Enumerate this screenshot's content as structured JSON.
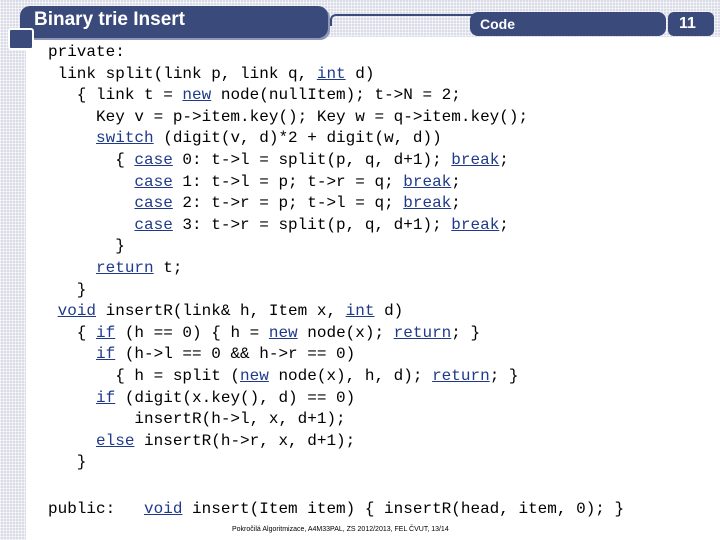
{
  "header": {
    "title": "Binary trie Insert",
    "code_label": "Code",
    "page_number": "11"
  },
  "code_lines": [
    [
      "private:"
    ],
    [
      " link split(link p, link q, ",
      {
        "kw": "int"
      },
      " d)"
    ],
    [
      "   { link t = ",
      {
        "kw": "new"
      },
      " node(nullItem); t->N = 2;"
    ],
    [
      "     Key v = p->item.key(); Key w = q->item.key();"
    ],
    [
      "     ",
      {
        "kw": "switch"
      },
      " (digit(v, d)*2 + digit(w, d))"
    ],
    [
      "       { ",
      {
        "kw": "case"
      },
      " 0: t->l = split(p, q, d+1); ",
      {
        "kw": "break"
      },
      ";"
    ],
    [
      "         ",
      {
        "kw": "case"
      },
      " 1: t->l = p; t->r = q; ",
      {
        "kw": "break"
      },
      ";"
    ],
    [
      "         ",
      {
        "kw": "case"
      },
      " 2: t->r = p; t->l = q; ",
      {
        "kw": "break"
      },
      ";"
    ],
    [
      "         ",
      {
        "kw": "case"
      },
      " 3: t->r = split(p, q, d+1); ",
      {
        "kw": "break"
      },
      ";"
    ],
    [
      "       }"
    ],
    [
      "     ",
      {
        "kw": "return"
      },
      " t;"
    ],
    [
      "   }"
    ],
    [
      " ",
      {
        "kw": "void"
      },
      " insertR(link& h, Item x, ",
      {
        "kw": "int"
      },
      " d)"
    ],
    [
      "   { ",
      {
        "kw": "if"
      },
      " (h == 0) { h = ",
      {
        "kw": "new"
      },
      " node(x); ",
      {
        "kw": "return"
      },
      "; }"
    ],
    [
      "     ",
      {
        "kw": "if"
      },
      " (h->l == 0 && h->r == 0)"
    ],
    [
      "       { h = split (",
      {
        "kw": "new"
      },
      " node(x), h, d); ",
      {
        "kw": "return"
      },
      "; }"
    ],
    [
      "     ",
      {
        "kw": "if"
      },
      " (digit(x.key(), d) == 0)"
    ],
    [
      "         insertR(h->l, x, d+1);"
    ],
    [
      "     ",
      {
        "kw": "else"
      },
      " insertR(h->r, x, d+1);"
    ],
    [
      "   }"
    ]
  ],
  "public_line": [
    "public:   ",
    {
      "kw": "void"
    },
    " insert(Item item) { insertR(head, item, 0); }"
  ],
  "footer": "Pokročilá Algoritmizace, A4M33PAL, ZS 2012/2013, FEL ČVUT,  13/14"
}
